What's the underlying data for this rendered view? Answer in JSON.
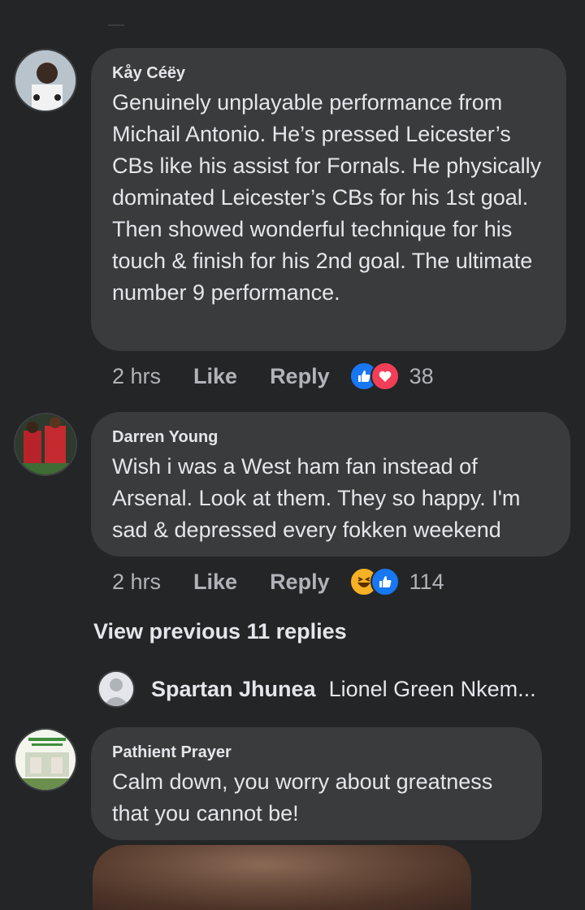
{
  "comments": [
    {
      "author": "Kåy Céëy",
      "text": "Genuinely unplayable performance from Michail Antonio. He’s pressed Leicester’s CBs like his assist for Fornals. He physically dominated Leicester’s CBs for his 1st goal. Then showed wonderful technique for his touch & finish for his 2nd goal. The ultimate number 9 performance.",
      "time": "2 hrs",
      "like_label": "Like",
      "reply_label": "Reply",
      "reactions": [
        "like-icon",
        "love-icon"
      ],
      "reaction_count": "38"
    },
    {
      "author": "Darren Young",
      "text": "Wish i was a West ham fan instead of Arsenal. Look at them. They so happy. I'm sad & depressed every fokken weekend",
      "time": "2 hrs",
      "like_label": "Like",
      "reply_label": "Reply",
      "reactions": [
        "haha-icon",
        "like-icon"
      ],
      "reaction_count": "114"
    },
    {
      "author": "Pathient Prayer",
      "text": "Calm down, you worry about greatness that you cannot be!"
    }
  ],
  "view_previous": "View previous 11 replies",
  "reply_preview": {
    "author": "Spartan Jhunea",
    "text": "Lionel Green Nkem..."
  },
  "colors": {
    "background": "#242526",
    "bubble": "#3a3b3c",
    "primary_text": "#e4e6eb",
    "secondary_text": "#b0b3b8",
    "like_blue": "#1877f2",
    "love_red": "#f33e58",
    "haha_yellow": "#f7b125"
  }
}
